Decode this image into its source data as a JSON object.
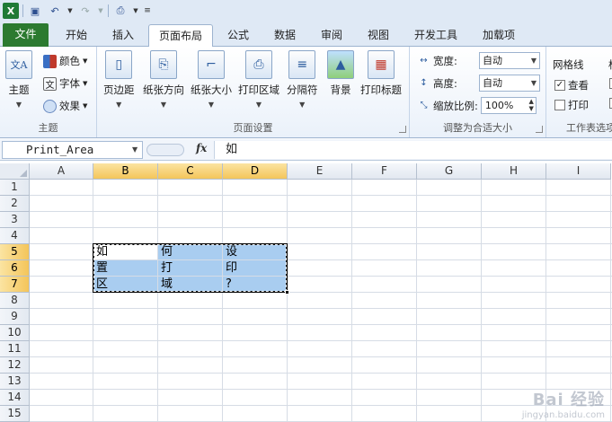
{
  "qat": {
    "items": [
      {
        "name": "excel-logo-icon"
      },
      {
        "name": "save-icon"
      },
      {
        "name": "undo-icon"
      },
      {
        "name": "redo-icon"
      },
      {
        "name": "print-preview-icon"
      },
      {
        "name": "customize-qat-icon"
      }
    ]
  },
  "tabs": {
    "file": "文件",
    "home": "开始",
    "insert": "插入",
    "page_layout": "页面布局",
    "formulas": "公式",
    "data": "数据",
    "review": "审阅",
    "view": "视图",
    "developer": "开发工具",
    "addins": "加载项"
  },
  "ribbon": {
    "themes": {
      "themes_btn": "主题",
      "colors": "颜色",
      "fonts": "字体",
      "effects": "效果",
      "group_label": "主题"
    },
    "page_setup": {
      "margins": "页边距",
      "orientation": "纸张方向",
      "size": "纸张大小",
      "print_area": "打印区域",
      "breaks": "分隔符",
      "background": "背景",
      "print_titles": "打印标题",
      "group_label": "页面设置"
    },
    "scale": {
      "width_label": "宽度:",
      "width_value": "自动",
      "height_label": "高度:",
      "height_value": "自动",
      "scale_label": "缩放比例:",
      "scale_value": "100%",
      "group_label": "调整为合适大小"
    },
    "sheet_options": {
      "gridlines": "网格线",
      "view": "查看",
      "view_checked": true,
      "print": "打印",
      "print_checked": false,
      "headings_partial": "标",
      "group_label": "工作表选项"
    }
  },
  "formula_bar": {
    "name_box": "Print_Area",
    "fx": "fx",
    "content": "如"
  },
  "sheet": {
    "columns": [
      "A",
      "B",
      "C",
      "D",
      "E",
      "F",
      "G",
      "H",
      "I"
    ],
    "selected_columns": [
      "B",
      "C",
      "D"
    ],
    "rows": [
      "1",
      "2",
      "3",
      "4",
      "5",
      "6",
      "7",
      "8",
      "9",
      "10",
      "11",
      "12",
      "13",
      "14",
      "15"
    ],
    "selected_rows": [
      "5",
      "6",
      "7"
    ],
    "cells": {
      "B5": "如",
      "C5": "何",
      "D5": "设",
      "B6": "置",
      "C6": "打",
      "D6": "印",
      "B7": "区",
      "C7": "域",
      "D7": "?"
    },
    "selection_color": "#a9cdf0"
  },
  "watermark": {
    "logo": "Bai 经验",
    "url": "jingyan.baidu.com"
  }
}
